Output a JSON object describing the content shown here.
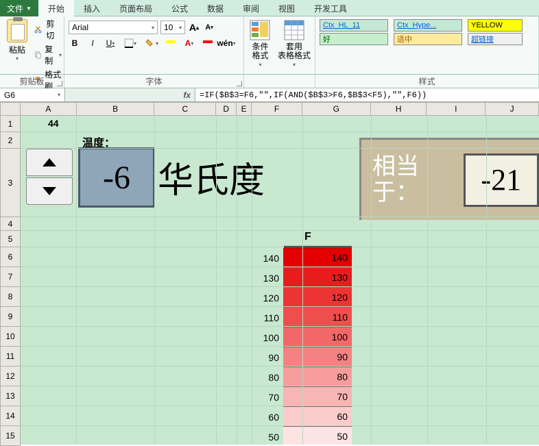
{
  "tabs": {
    "file": "文件",
    "home": "开始",
    "insert": "插入",
    "layout": "页面布局",
    "formula": "公式",
    "data": "数据",
    "review": "审阅",
    "view": "视图",
    "dev": "开发工具"
  },
  "clipboard": {
    "paste": "粘贴",
    "cut": "剪切",
    "copy": "复制",
    "brush": "格式刷",
    "label": "剪贴板"
  },
  "font": {
    "name": "Arial",
    "size": "10",
    "label": "字体"
  },
  "formats": {
    "cond": "条件格式",
    "table": "套用\n表格格式"
  },
  "styles": {
    "ctx1": "Ctx_HL_11",
    "ctx2": "Ctx_Hype...",
    "yellow": "YELLOW",
    "good": "好",
    "neutral": "适中",
    "link": "超链接",
    "label": "样式"
  },
  "name_box": "G6",
  "formula": "=IF($B$3=F6,\"\",IF(AND($B$3>F6,$B$3<F5),\"\",F6))",
  "sheet": {
    "a1": "44",
    "temp_label": "温度：",
    "temp_value": "-6",
    "unit": "华氏度",
    "equiv_label": "相当于：",
    "equiv_value": "-21",
    "f_header": "F"
  },
  "cols": {
    "A": 82,
    "B": 114,
    "C": 90,
    "D": 30,
    "E": 22,
    "F": 74,
    "G": 100,
    "H": 82,
    "I": 86,
    "J": 78
  },
  "row_nums": [
    "1",
    "2",
    "3",
    "4",
    "5",
    "6",
    "7",
    "8",
    "9",
    "10",
    "11",
    "12",
    "13",
    "14",
    "15"
  ],
  "chart_data": {
    "type": "table",
    "title": "F",
    "columns": [
      "F_label",
      "F_value"
    ],
    "rows": [
      {
        "label": 140,
        "value": 140,
        "color": "#e30000"
      },
      {
        "label": 130,
        "value": 130,
        "color": "#e81c1c"
      },
      {
        "label": 120,
        "value": 120,
        "color": "#ec3434"
      },
      {
        "label": 110,
        "value": 110,
        "color": "#ef4e4e"
      },
      {
        "label": 100,
        "value": 100,
        "color": "#f26868"
      },
      {
        "label": 90,
        "value": 90,
        "color": "#f58282"
      },
      {
        "label": 80,
        "value": 80,
        "color": "#f79c9c"
      },
      {
        "label": 70,
        "value": 70,
        "color": "#f9b4b4"
      },
      {
        "label": 60,
        "value": 60,
        "color": "#fbcccc"
      },
      {
        "label": 50,
        "value": 50,
        "color": "#fde4e4"
      }
    ]
  }
}
